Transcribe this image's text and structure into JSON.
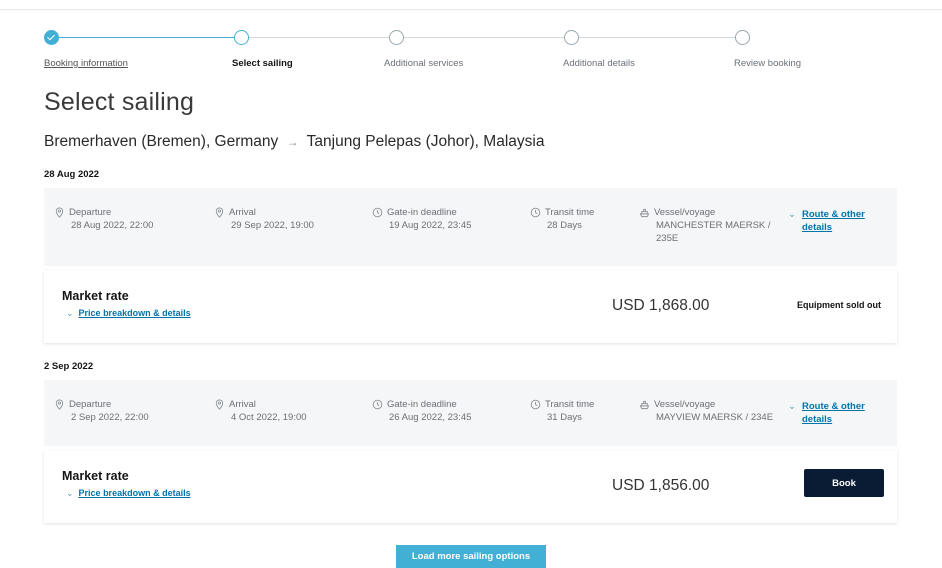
{
  "stepper": {
    "steps": [
      {
        "label": "Booking information",
        "state": "done"
      },
      {
        "label": "Select sailing",
        "state": "current"
      },
      {
        "label": "Additional services",
        "state": "pending"
      },
      {
        "label": "Additional details",
        "state": "pending"
      },
      {
        "label": "Review booking",
        "state": "pending"
      }
    ]
  },
  "page_title": "Select sailing",
  "route": {
    "origin": "Bremerhaven (Bremen), Germany",
    "arrow": "→",
    "destination": "Tanjung Pelepas (Johor), Malaysia"
  },
  "sailings": [
    {
      "date": "28 Aug 2022",
      "departure_label": "Departure",
      "departure": "28 Aug 2022, 22:00",
      "arrival_label": "Arrival",
      "arrival": "29 Sep 2022, 19:00",
      "gate_label": "Gate-in deadline",
      "gate": "19 Aug 2022, 23:45",
      "transit_label": "Transit time",
      "transit": "28 Days",
      "vessel_label": "Vessel/voyage",
      "vessel_line1": "MANCHESTER MAERSK /",
      "vessel_line2": "235E",
      "route_link_line1": "Route & other",
      "route_link_line2": "details",
      "rate_title": "Market rate",
      "breakdown": "Price breakdown & details",
      "price": "USD 1,868.00",
      "status": "Equipment sold out"
    },
    {
      "date": "2 Sep 2022",
      "departure_label": "Departure",
      "departure": "2 Sep 2022, 22:00",
      "arrival_label": "Arrival",
      "arrival": "4 Oct 2022, 19:00",
      "gate_label": "Gate-in deadline",
      "gate": "26 Aug 2022, 23:45",
      "transit_label": "Transit time",
      "transit": "31 Days",
      "vessel_label": "Vessel/voyage",
      "vessel_line1": "MAYVIEW MAERSK / 234E",
      "route_link_line1": "Route & other",
      "route_link_line2": "details",
      "rate_title": "Market rate",
      "breakdown": "Price breakdown & details",
      "price": "USD 1,856.00",
      "book_label": "Book"
    }
  ],
  "load_more": "Load more sailing options",
  "colors": {
    "accent": "#42b0d5",
    "link": "#0073ab",
    "book_button": "#0a1b34",
    "card_bg": "#f5f6f7"
  }
}
